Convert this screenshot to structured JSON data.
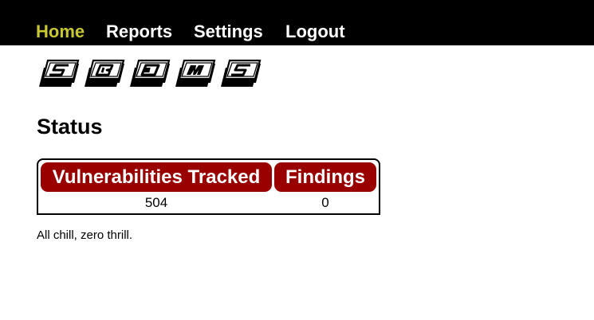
{
  "nav": {
    "items": [
      {
        "label": "Home",
        "active": true
      },
      {
        "label": "Reports",
        "active": false
      },
      {
        "label": "Settings",
        "active": false
      },
      {
        "label": "Logout",
        "active": false
      }
    ],
    "active_color": "#c8c832"
  },
  "logo": {
    "letters": [
      "S",
      "B",
      "O",
      "M",
      "S"
    ]
  },
  "page": {
    "title": "Status"
  },
  "status_table": {
    "columns": [
      "Vulnerabilities Tracked",
      "Findings"
    ],
    "values": [
      "504",
      "0"
    ],
    "header_color": "#990000"
  },
  "status_message": "All chill, zero thrill."
}
